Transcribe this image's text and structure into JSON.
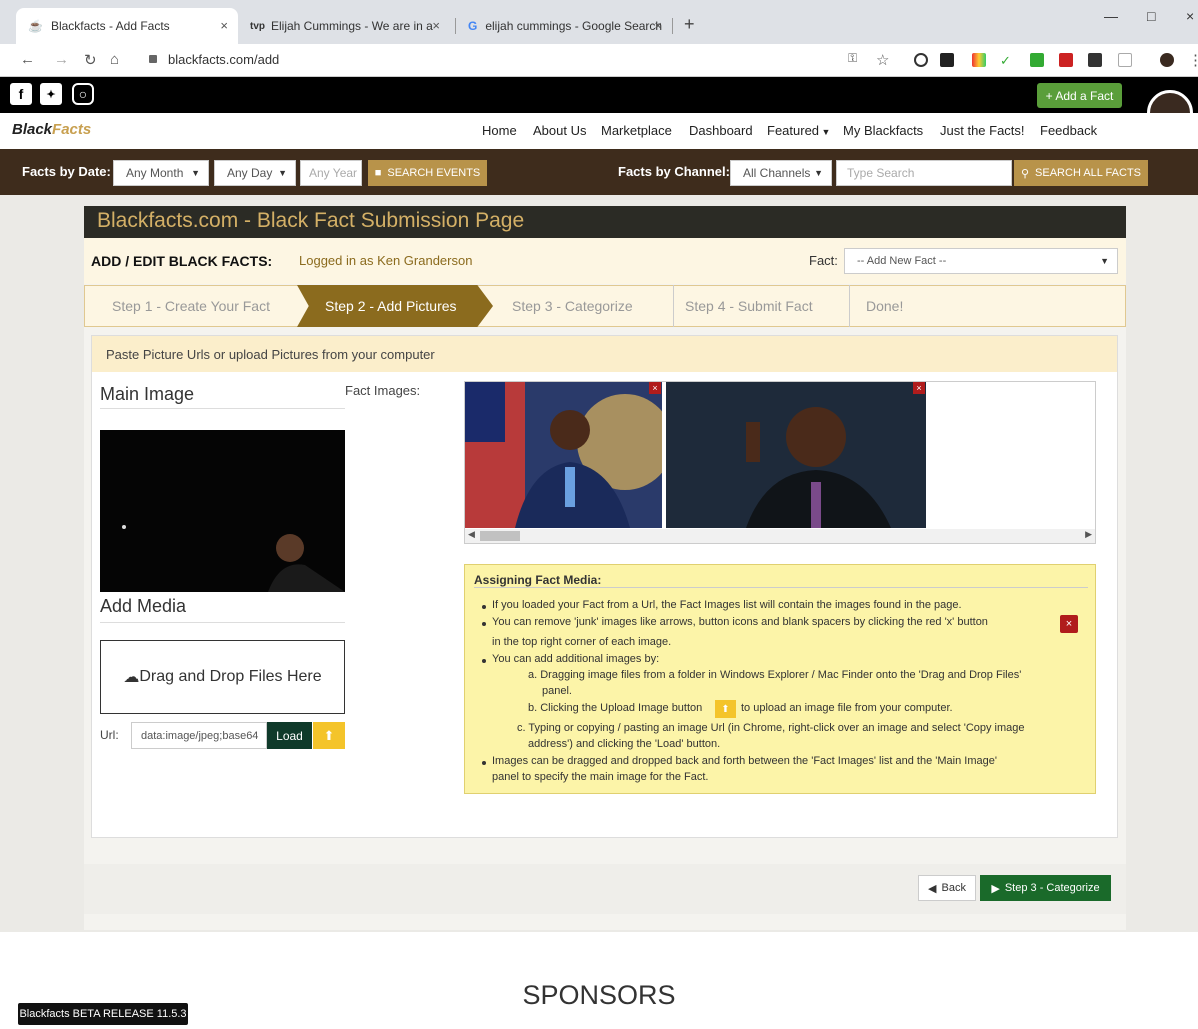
{
  "browser": {
    "tabs": [
      {
        "label": "Blackfacts - Add Facts"
      },
      {
        "label": "Elijah Cummings - We are in a fig"
      },
      {
        "label": "elijah cummings - Google Search"
      }
    ],
    "url": "blackfacts.com/add"
  },
  "social": {
    "add_fact": "+ Add a Fact"
  },
  "nav": {
    "logo_black": "Black",
    "logo_facts": "Facts",
    "items": [
      "Home",
      "About Us",
      "Marketplace",
      "Dashboard",
      "Featured",
      "My Blackfacts",
      "Just the Facts!",
      "Feedback"
    ]
  },
  "filter": {
    "by_date_label": "Facts by Date:",
    "month": "Any Month",
    "day": "Any Day",
    "year_placeholder": "Any Year",
    "search_events": "SEARCH EVENTS",
    "by_channel_label": "Facts by Channel:",
    "channel": "All Channels",
    "search_placeholder": "Type Search",
    "search_all": "SEARCH ALL FACTS"
  },
  "page": {
    "title": "Blackfacts.com - Black Fact Submission Page",
    "add_edit": "ADD / EDIT BLACK FACTS:",
    "logged_in": "Logged in as Ken Granderson",
    "fact_label": "Fact:",
    "fact_select": "-- Add New Fact --"
  },
  "steps": [
    "Step 1 - Create Your Fact",
    "Step 2 - Add Pictures",
    "Step 3 - Categorize",
    "Step 4 - Submit Fact",
    "Done!"
  ],
  "media": {
    "paste_hint": "Paste Picture Urls or upload Pictures from your computer",
    "main_image": "Main Image",
    "fact_images": "Fact Images:",
    "add_media": "Add Media",
    "drag_drop": "Drag and Drop Files Here",
    "url_label": "Url:",
    "url_value": "data:image/jpeg;base64",
    "load": "Load"
  },
  "help": {
    "title": "Assigning Fact Media:",
    "lines": [
      "If you loaded your Fact from a Url, the Fact Images list will contain the images found in the page.",
      "You can remove 'junk' images like arrows, button icons and blank spacers by clicking the red 'x' button",
      "in the top right corner of each image.",
      "You can add additional images by:",
      "a. Dragging image files from a folder in Windows Explorer / Mac Finder onto the 'Drag and Drop Files'",
      "panel.",
      "b. Clicking the Upload Image button",
      "to upload an image file from your computer.",
      "c. Typing or copying / pasting an image Url (in Chrome, right-click over an image and select 'Copy image",
      "address') and clicking the 'Load' button.",
      "Images can be dragged and dropped back and forth between the 'Fact Images' list and the 'Main Image'",
      "panel to specify the main image for the Fact."
    ]
  },
  "footer": {
    "back": "Back",
    "next": "Step 3 - Categorize",
    "sponsors": "SPONSORS",
    "beta": "Blackfacts BETA RELEASE 11.5.3"
  }
}
